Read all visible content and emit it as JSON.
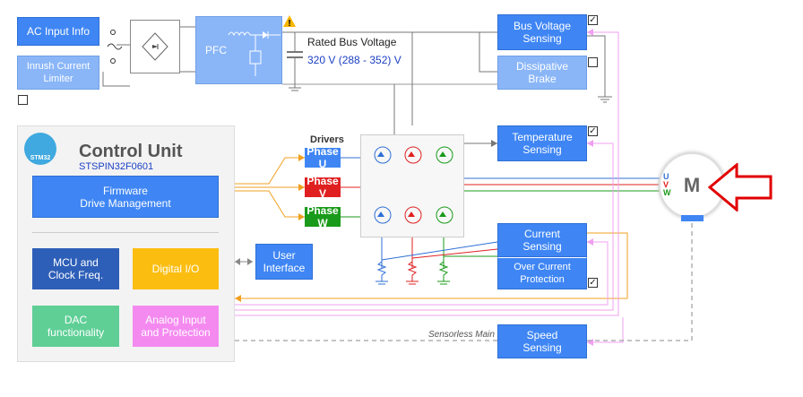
{
  "ac_input": {
    "label": "AC Input Info"
  },
  "inrush": {
    "label": "Inrush Current\nLimiter"
  },
  "pfc": {
    "label": "PFC"
  },
  "bus": {
    "title": "Rated Bus Voltage",
    "value": "320 V (288 - 352) V"
  },
  "bus_voltage_sensing": {
    "label": "Bus Voltage\nSensing",
    "checked": "✓"
  },
  "dissipative_brake": {
    "label": "Dissipative\nBrake"
  },
  "control_unit": {
    "title": "Control Unit",
    "part": "STSPIN32F0601",
    "logo": "STM32"
  },
  "firmware": {
    "label": "Firmware\nDrive Management"
  },
  "mcu": {
    "label": "MCU and\nClock Freq."
  },
  "digital_io": {
    "label": "Digital I/O"
  },
  "dac": {
    "label": "DAC\nfunctionality"
  },
  "analog_input": {
    "label": "Analog Input\nand Protection"
  },
  "user_interface": {
    "label": "User\nInterface"
  },
  "drivers": {
    "title": "Drivers",
    "phase_u": "Phase U",
    "phase_v": "Phase V",
    "phase_w": "Phase W"
  },
  "temperature_sensing": {
    "label": "Temperature\nSensing",
    "checked": "✓"
  },
  "current_sensing": {
    "label": "Current\nSensing"
  },
  "over_current": {
    "label": "Over Current\nProtection",
    "checked": "✓"
  },
  "speed_sensing": {
    "label": "Speed\nSensing"
  },
  "sensorless": {
    "label": "Sensorless Main"
  },
  "motor": {
    "label": "M",
    "u": "U",
    "v": "V",
    "w": "W"
  },
  "colors": {
    "blue": "#3f86f4",
    "light_blue": "#8ab6f8",
    "dark_blue": "#2e5fb8",
    "yellow": "#fbbd10",
    "green": "#5fcf96",
    "pink": "#f48af0",
    "phase_red": "#e02020",
    "phase_green": "#1a9a1a",
    "wire_orange": "#f0a020",
    "wire_pink": "#f0a0f0",
    "arrow_red": "#e00000"
  }
}
